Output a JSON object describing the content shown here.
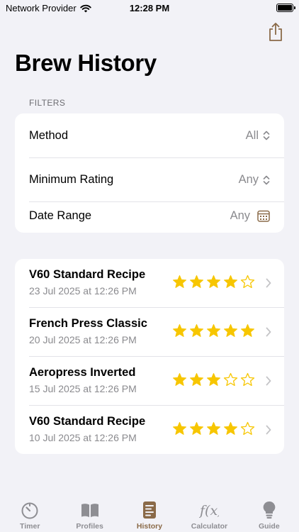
{
  "status": {
    "carrier": "Network Provider",
    "time": "12:28 PM"
  },
  "header": {
    "title": "Brew History"
  },
  "filters": {
    "section_label": "FILTERS",
    "rows": [
      {
        "label": "Method",
        "value": "All"
      },
      {
        "label": "Minimum Rating",
        "value": "Any"
      },
      {
        "label": "Date Range",
        "value": "Any"
      }
    ]
  },
  "history": [
    {
      "title": "V60 Standard Recipe",
      "date": "23 Jul 2025 at 12:26 PM",
      "rating": 4
    },
    {
      "title": "French Press Classic",
      "date": "20 Jul 2025 at 12:26 PM",
      "rating": 5
    },
    {
      "title": "Aeropress Inverted",
      "date": "15 Jul 2025 at 12:26 PM",
      "rating": 3
    },
    {
      "title": "V60 Standard Recipe",
      "date": "10 Jul 2025 at 12:26 PM",
      "rating": 4
    }
  ],
  "tabs": [
    {
      "label": "Timer",
      "icon": "timer-icon"
    },
    {
      "label": "Profiles",
      "icon": "book-icon"
    },
    {
      "label": "History",
      "icon": "history-icon"
    },
    {
      "label": "Calculator",
      "icon": "function-icon"
    },
    {
      "label": "Guide",
      "icon": "lightbulb-icon"
    }
  ],
  "colors": {
    "accent": "#8a6a48",
    "star": "#f7c600",
    "background": "#f2f2f7"
  }
}
